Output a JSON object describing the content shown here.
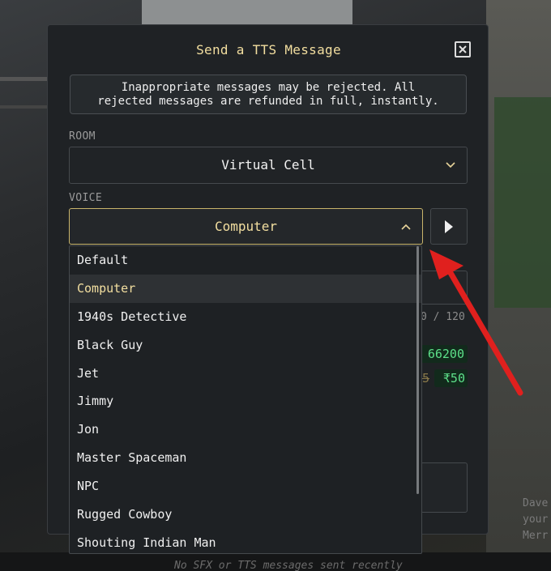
{
  "modal": {
    "title": "Send a TTS Message",
    "notice_line1": "Inappropriate messages may be rejected. All",
    "notice_line2": "rejected messages are refunded in full, instantly."
  },
  "room": {
    "label": "ROOM",
    "value": "Virtual Cell"
  },
  "voice": {
    "label": "VOICE",
    "value": "Computer",
    "options": [
      "Default",
      "Computer",
      "1940s Detective",
      "Black Guy",
      "Jet",
      "Jimmy",
      "Jon",
      "Master Spaceman",
      "NPC",
      "Rugged Cowboy",
      "Shouting Indian Man"
    ],
    "selected_index": 1
  },
  "partial": {
    "counter": "0 / 120",
    "price1": "66200",
    "price_old": "5",
    "price2": "₹50"
  },
  "background": {
    "bottom_text": "No SFX or TTS messages sent recently",
    "side_text_1": "Dave",
    "side_text_2": "your",
    "side_text_3": "Merr"
  },
  "colors": {
    "accent": "#f3dfa0",
    "arrow": "#e0201e",
    "price_green": "#5de08a"
  }
}
